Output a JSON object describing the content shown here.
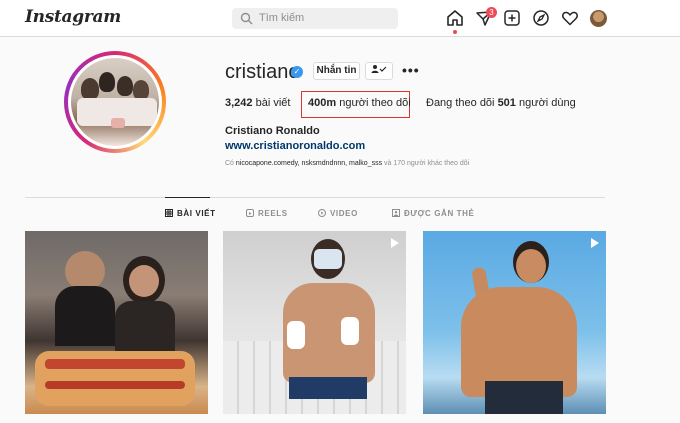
{
  "header": {
    "logo": "Instagram",
    "search_placeholder": "Tìm kiếm",
    "notification_count": "3"
  },
  "profile": {
    "username": "cristiano",
    "message_button": "Nhắn tin",
    "posts": {
      "count": "3,242",
      "label": "bài viết"
    },
    "followers": {
      "count": "400m",
      "label": "người theo dõi"
    },
    "following": {
      "prefix": "Đang theo dõi",
      "count": "501",
      "label": "người dùng"
    },
    "full_name": "Cristiano Ronaldo",
    "website": "www.cristianoronaldo.com",
    "followed_by": {
      "prefix": "Có",
      "names": "nicocapone.comedy, nsksmdndnnn, malko_sss",
      "suffix": "và 170 người khác theo dõi"
    }
  },
  "tabs": [
    "BÀI VIẾT",
    "REELS",
    "VIDEO",
    "ĐƯỢC GẮN THẺ"
  ],
  "colors": {
    "accent": "#0095f6",
    "highlight_box": "#e0332f",
    "verified": "#3897f0",
    "link": "#00376b"
  },
  "icons": [
    "search-icon",
    "home-icon",
    "messenger-icon",
    "new-post-icon",
    "explore-icon",
    "heart-icon",
    "verified-icon",
    "follow-user-icon",
    "more-icon",
    "grid-icon",
    "reels-icon",
    "video-icon",
    "tagged-icon",
    "reel-icon"
  ]
}
